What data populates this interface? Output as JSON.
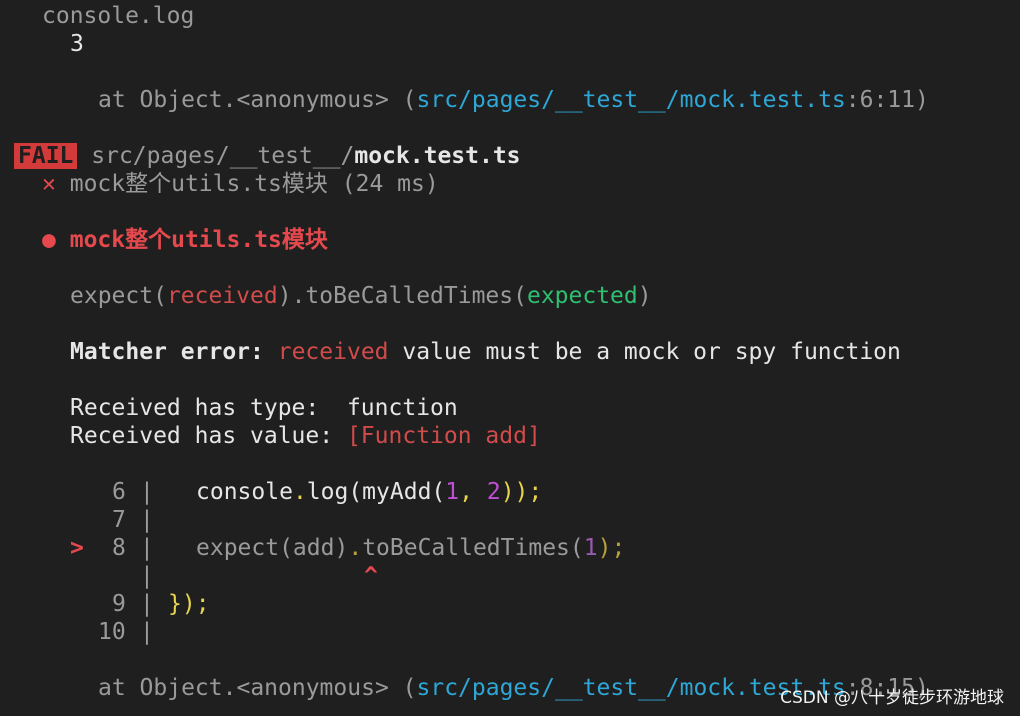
{
  "console": {
    "label": "console.log",
    "value": "3",
    "at_prefix": "at Object.<anonymous> (",
    "path": "src/pages/__test__/mock.test.ts",
    "loc": ":6:11)"
  },
  "fail": {
    "badge": "FAIL",
    "dir": "src/pages/__test__/",
    "file": "mock.test.ts"
  },
  "test_result": {
    "cross": "✕",
    "name": "mock整个utils.ts模块",
    "duration": "(24 ms)"
  },
  "error_heading": {
    "bullet": "●",
    "title": "mock整个utils.ts模块"
  },
  "expect_line": {
    "expect": "expect(",
    "received": "received",
    "mid": ").toBeCalledTimes(",
    "expected": "expected",
    "close": ")"
  },
  "matcher": {
    "label": "Matcher error:",
    "received": "received",
    "rest": "value must be a mock or spy function"
  },
  "received_info": {
    "type_label": "Received has type:  ",
    "type_value": "function",
    "value_label": "Received has value: ",
    "value_value": "[Function add]"
  },
  "code": {
    "l6_num": "6",
    "l6_a": "console",
    "l6_dot": ".",
    "l6_b": "log(myAdd(",
    "l6_n1": "1",
    "l6_comma": ", ",
    "l6_n2": "2",
    "l6_end": "));",
    "l7_num": "7",
    "marker": ">",
    "l8_num": "8",
    "l8_a": "expect(add)",
    "l8_dot": ".",
    "l8_b": "toBeCalledTimes(",
    "l8_n": "1",
    "l8_end": ");",
    "caret": "^",
    "l9_num": "9",
    "l9_code": "});",
    "l10_num": "10",
    "bar": "|"
  },
  "final_at": {
    "at_prefix": "at Object.<anonymous> (",
    "path": "src/pages/__test__/mock.test.ts",
    "loc": ":8:15)"
  },
  "watermark": "CSDN @八十岁徒步环游地球",
  "colors": {
    "background": "#1f1f1f",
    "fail_badge": "#d33a3a",
    "error_red": "#e5484d",
    "path_cyan": "#2ea7d6",
    "expected_green": "#2fbf71",
    "number_magenta": "#c14fd6",
    "dot_yellow": "#e8d44d"
  }
}
